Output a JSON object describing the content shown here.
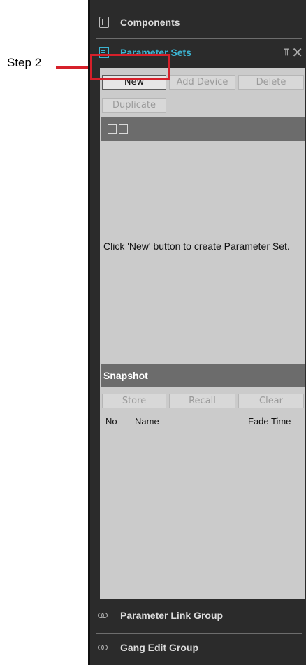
{
  "annotation": {
    "step_label": "Step 2"
  },
  "panel": {
    "components_label": "Components",
    "parameter_sets_label": "Parameter Sets",
    "pin_glyph": "・",
    "close_glyph": "✕"
  },
  "buttons": {
    "new": "New",
    "add_device": "Add Device",
    "delete": "Delete",
    "duplicate": "Duplicate"
  },
  "hint_text": "Click 'New' button to create Parameter Set.",
  "snapshot": {
    "title": "Snapshot",
    "store": "Store",
    "recall": "Recall",
    "clear": "Clear",
    "columns": {
      "no": "No",
      "name": "Name",
      "fade_time": "Fade Time"
    }
  },
  "bottom": {
    "parameter_link_group": "Parameter Link Group",
    "gang_edit_group": "Gang Edit Group"
  },
  "colors": {
    "accent": "#3cb4d2",
    "annotation": "#d6202a",
    "panel_bg": "#2b2b2b",
    "content_bg": "#cbcbcb"
  }
}
